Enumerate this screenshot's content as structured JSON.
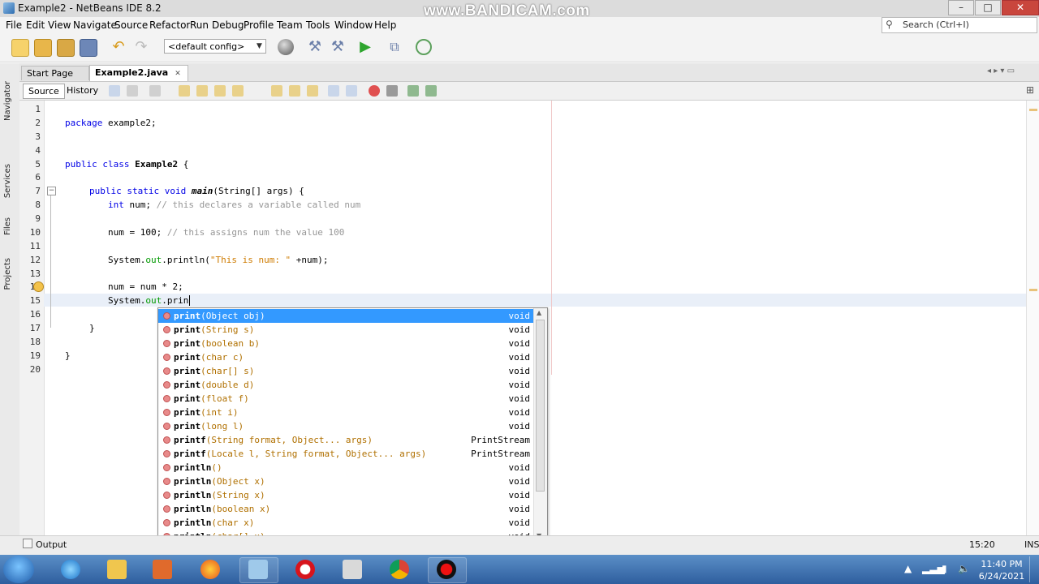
{
  "window": {
    "title": "Example2 - NetBeans IDE 8.2",
    "watermark": "www.BANDICAM.com",
    "buttons": [
      "–",
      "□",
      "✕"
    ]
  },
  "menu": [
    "File",
    "Edit",
    "View",
    "Navigate",
    "Source",
    "Refactor",
    "Run",
    "Debug",
    "Profile",
    "Team",
    "Tools",
    "Window",
    "Help"
  ],
  "search": {
    "placeholder": "Search (Ctrl+I)"
  },
  "toolbar": {
    "config": "<default config>"
  },
  "side_tabs": [
    "Navigator",
    "Services",
    "Files",
    "Projects"
  ],
  "tabs": [
    {
      "label": "Start Page"
    },
    {
      "label": "Example2.java"
    }
  ],
  "editor_modes": {
    "source": "Source",
    "history": "History"
  },
  "line_numbers": [
    "1",
    "2",
    "3",
    "4",
    "5",
    "6",
    "7",
    "8",
    "9",
    "10",
    "11",
    "12",
    "13",
    "14",
    "15",
    "16",
    "17",
    "18",
    "19",
    "20"
  ],
  "code": {
    "l2_kw": "package",
    "l2_rest": " example2;",
    "l5_kw": "public class",
    "l5_name": " Example2",
    "l5_rest": " {",
    "l7_kw": "public static void",
    "l7_name": " main",
    "l7_rest": "(String[] args) {",
    "l8_kw": "int",
    "l8_rest": " num;",
    "l8_cm": " // this declares a variable called num",
    "l10_code": "num = 100;",
    "l10_cm": " // this assigns num the value 100",
    "l12_a": "System.",
    "l12_fld": "out",
    "l12_b": ".println(",
    "l12_str": "\"This is num: \"",
    "l12_c": " +num);",
    "l14_code": "num = num * 2;",
    "l15_a": "System.",
    "l15_fld": "out",
    "l15_b": ".prin",
    "l17": "}",
    "l19": "}"
  },
  "completion": [
    {
      "name": "print",
      "params": "(Object obj)",
      "ret": "void"
    },
    {
      "name": "print",
      "params": "(String s)",
      "ret": "void"
    },
    {
      "name": "print",
      "params": "(boolean b)",
      "ret": "void"
    },
    {
      "name": "print",
      "params": "(char c)",
      "ret": "void"
    },
    {
      "name": "print",
      "params": "(char[] s)",
      "ret": "void"
    },
    {
      "name": "print",
      "params": "(double d)",
      "ret": "void"
    },
    {
      "name": "print",
      "params": "(float f)",
      "ret": "void"
    },
    {
      "name": "print",
      "params": "(int i)",
      "ret": "void"
    },
    {
      "name": "print",
      "params": "(long l)",
      "ret": "void"
    },
    {
      "name": "printf",
      "params": "(String format, Object... args)",
      "ret": "PrintStream"
    },
    {
      "name": "printf",
      "params": "(Locale l, String format, Object... args)",
      "ret": "PrintStream"
    },
    {
      "name": "println",
      "params": "()",
      "ret": "void"
    },
    {
      "name": "println",
      "params": "(Object x)",
      "ret": "void"
    },
    {
      "name": "println",
      "params": "(String x)",
      "ret": "void"
    },
    {
      "name": "println",
      "params": "(boolean x)",
      "ret": "void"
    },
    {
      "name": "println",
      "params": "(char x)",
      "ret": "void"
    },
    {
      "name": "println",
      "params": "(char[] x)",
      "ret": "void"
    }
  ],
  "status": {
    "output": "Output",
    "position": "15:20",
    "mode": "INS"
  },
  "taskbar": {
    "time": "11:40 PM",
    "date": "6/24/2021"
  }
}
